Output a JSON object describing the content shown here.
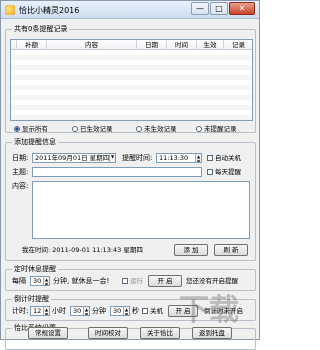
{
  "window": {
    "title": "恰比小精灵2016",
    "min": "—",
    "max": "□",
    "close": "✕"
  },
  "list": {
    "legend": "共有0条提醒记录",
    "columns": [
      "补额",
      "内容",
      "日期",
      "时间",
      "生效",
      "记录"
    ],
    "filters": [
      {
        "label": "显示所有",
        "checked": true
      },
      {
        "label": "已生效记录",
        "checked": false
      },
      {
        "label": "未生效记录",
        "checked": false
      },
      {
        "label": "未提醒记录",
        "checked": false
      }
    ]
  },
  "add": {
    "legend": "添加提醒信息",
    "date_label": "日期:",
    "date_value": "2011年09月01日 星期四",
    "remind_time_label": "提醒时间:",
    "remind_time_value": "11:13:30",
    "auto_shutdown": "自动关机",
    "subject_label": "主题:",
    "daily": "每天提醒",
    "content_label": "内容:",
    "now_text": "我在时间: 2011-09-01 11:13:43 星期四",
    "add_btn": "添 加",
    "refresh_btn": "刷 新"
  },
  "rest": {
    "legend": "定时休息提醒",
    "every": "每隔",
    "minutes": "30",
    "after": "分钟, 就休息一会!",
    "run": "运行",
    "start": "开 启",
    "status": "您还没有开启提醒"
  },
  "countdown": {
    "legend": "倒计时提醒",
    "time_label": "计时:",
    "hours": "12",
    "h_unit": "小时",
    "mins": "30",
    "m_unit": "分钟",
    "secs": "30",
    "s_unit": "秒",
    "shutdown": "关机",
    "start": "开 启",
    "status": "倒计时未开启"
  },
  "sys": {
    "legend": "恰比系统设置",
    "settings": "常规设置",
    "timesync": "时间校对",
    "about": "关于恰比",
    "tray": "返到托盘"
  },
  "watermark": "下载"
}
